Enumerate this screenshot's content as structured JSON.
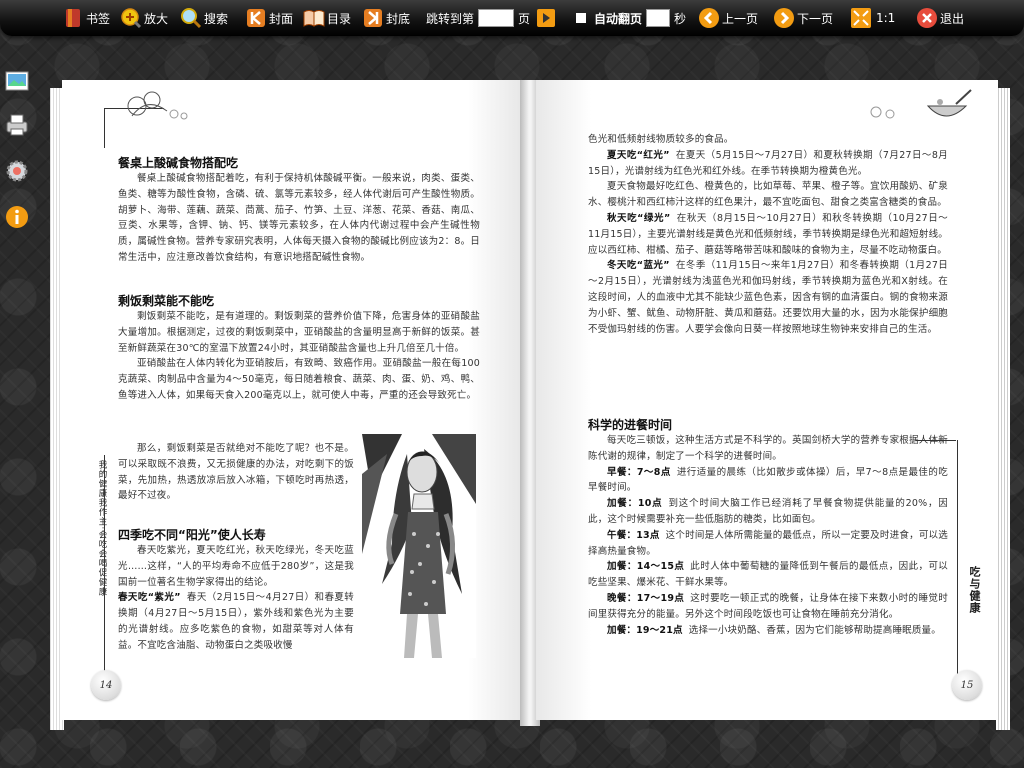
{
  "toolbar": {
    "bookmark": "书签",
    "zoom": "放大",
    "search": "搜索",
    "cover": "封面",
    "toc": "目录",
    "backcover": "封底",
    "jump_prefix": "跳转到第",
    "jump_suffix": "页",
    "autoflip": "自动翻页",
    "seconds": "秒",
    "prev": "上一页",
    "next": "下一页",
    "ratio": "1:1",
    "exit": "退出"
  },
  "side_icons": [
    "picture-icon",
    "print-icon",
    "settings-gear-icon",
    "info-icon"
  ],
  "left_page": {
    "page_number": "14",
    "vertical_caption": "我的健康我作主·会吃会喝促健康",
    "sections": [
      {
        "title": "餐桌上酸碱食物搭配吃",
        "paragraphs": [
          "餐桌上酸碱食物搭配着吃，有利于保持机体酸碱平衡。一般来说，肉类、蛋类、鱼类、糖等为酸性食物，含磷、硫、氯等元素较多，经人体代谢后可产生酸性物质。胡萝卜、海带、莲藕、蔬菜、茼蒿、茄子、竹笋、土豆、洋葱、花菜、香菇、南瓜、豆类、水果等，含钾、钠、钙、镁等元素较多，在人体内代谢过程中会产生碱性物质，属碱性食物。营养专家研究表明，人体每天摄入食物的酸碱比例应该为2：8。日常生活中，应注意改善饮食结构，有意识地搭配碱性食物。"
        ]
      },
      {
        "title": "剩饭剩菜能不能吃",
        "paragraphs": [
          "剩饭剩菜不能吃，是有道理的。剩饭剩菜的营养价值下降，危害身体的亚硝酸盐大量增加。根据测定，过夜的剩饭剩菜中，亚硝酸盐的含量明显高于新鲜的饭菜。甚至新鲜蔬菜在30℃的室温下放置24小时，其亚硝酸盐含量也上升几倍至几十倍。",
          "亚硝酸盐在人体内转化为亚硝胺后，有致畸、致癌作用。亚硝酸盐一般在每100克蔬菜、肉制品中含量为4～50毫克，每日随着粮食、蔬菜、肉、蛋、奶、鸡、鸭、鱼等进入人体，如果每天食入200毫克以上，就可使人中毒，严重的还会导致死亡。",
          "那么，剩饭剩菜是否就绝对不能吃了呢？也不是。可以采取既不浪费，又无损健康的办法，对吃剩下的饭菜，先加热，热透放凉后放入冰箱，下顿吃时再热透，最好不过夜。"
        ]
      },
      {
        "title": "四季吃不同“阳光”使人长寿",
        "paragraphs": [
          "春天吃紫光，夏天吃红光，秋天吃绿光，冬天吃蓝光……这样，“人的平均寿命不应低于280岁”，这是我国前一位著名生物学家得出的结论。"
        ],
        "spring_label": "春天吃“紫光”",
        "spring_text": "春天（2月15日～4月27日）和春夏转换期（4月27日～5月15日），紫外线和紫色光为主要的光谱射线。应多吃紫色的食物，如甜菜等对人体有益。不宜吃含油脂、动物蛋白之类吸收慢"
      }
    ]
  },
  "right_page": {
    "page_number": "15",
    "vertical_caption": "吃与健康",
    "continuation": "色光和低频射线物质较多的食品。",
    "seasons": [
      {
        "label": "夏天吃“红光”",
        "text": "在夏天（5月15日～7月27日）和夏秋转换期（7月27日～8月15日），光谱射线为红色光和红外线。在季节转换期为橙黄色光。"
      },
      {
        "label": "",
        "text": "夏天食物最好吃红色、橙黄色的，比如草莓、苹果、橙子等。宜饮用酸奶、矿泉水、樱桃汁和西红柿汁这样的红色果汁，最不宜吃面包、甜食之类富含糖类的食品。"
      },
      {
        "label": "秋天吃“绿光”",
        "text": "在秋天（8月15日～10月27日）和秋冬转换期（10月27日～11月15日），主要光谱射线是黄色光和低频射线，季节转换期是绿色光和超短射线。应以西红柿、柑橘、茄子、蘑菇等略带苦味和酸味的食物为主，尽量不吃动物蛋白。"
      },
      {
        "label": "冬天吃“蓝光”",
        "text": "在冬季（11月15日～来年1月27日）和冬春转换期（1月27日～2月15日），光谱射线为浅蓝色光和伽玛射线，季节转换期为蓝色光和X射线。在这段时间，人的血液中尤其不能缺少蓝色色素，因含有钢的血清蛋白。钢的食物来源为小虾、蟹、鱿鱼、动物肝脏、黄瓜和蘑菇。还要饮用大量的水，因为水能保护细胞不受伽玛射线的伤害。人要学会像向日葵一样按照地球生物钟来安排自己的生活。"
      }
    ],
    "section_title": "科学的进餐时间",
    "intro": "每天吃三顿饭，这种生活方式是不科学的。英国剑桥大学的营养专家根据人体新陈代谢的规律，制定了一个科学的进餐时间。",
    "meals": [
      {
        "label": "早餐：7～8点",
        "text": "进行适量的晨练（比如散步或体操）后，早7～8点是最佳的吃早餐时间。"
      },
      {
        "label": "加餐：10点",
        "text": "到这个时间大脑工作已经消耗了早餐食物提供能量的20%，因此，这个时候需要补充一些低脂肪的糖类，比如面包。"
      },
      {
        "label": "午餐：13点",
        "text": "这个时间是人体所需能量的最低点，所以一定要及时进食，可以选择高热量食物。"
      },
      {
        "label": "加餐：14～15点",
        "text": "此时人体中葡萄糖的量降低到午餐后的最低点，因此，可以吃些坚果、爆米花、干鲜水果等。"
      },
      {
        "label": "晚餐：17～19点",
        "text": "这时要吃一顿正式的晚餐，让身体在接下来数小时的睡觉时间里获得充分的能量。另外这个时间段吃饭也可让食物在睡前充分消化。"
      },
      {
        "label": "加餐：19～21点",
        "text": "选择一小块奶酪、香蕉，因为它们能够帮助提高睡眠质量。"
      }
    ]
  }
}
